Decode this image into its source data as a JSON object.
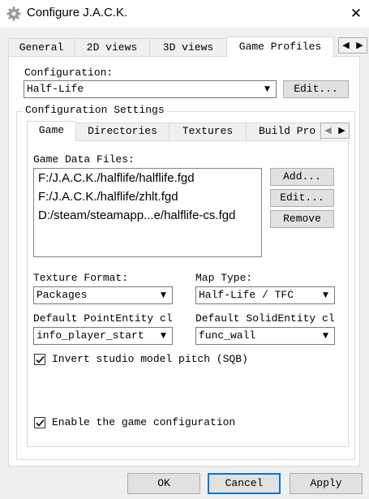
{
  "window": {
    "title": "Configure J.A.C.K.",
    "close_glyph": "✕",
    "icon": "gear-icon"
  },
  "outer_tabs": [
    {
      "label": "General"
    },
    {
      "label": "2D views"
    },
    {
      "label": "3D views"
    },
    {
      "label": "Game Profiles"
    }
  ],
  "outer_tabs_active": "Game Profiles",
  "scroll_arrows": {
    "left": "◀",
    "right": "▶"
  },
  "configuration": {
    "label": "Configuration:",
    "value": "Half-Life",
    "edit_button": "Edit..."
  },
  "settings_group": {
    "title": "Configuration Settings"
  },
  "inner_tabs": [
    {
      "label": "Game"
    },
    {
      "label": "Directories"
    },
    {
      "label": "Textures"
    },
    {
      "label": "Build Pro"
    }
  ],
  "inner_tabs_active": "Game",
  "game": {
    "data_files_label": "Game Data Files:",
    "data_files": [
      "F:/J.A.C.K./halflife/halflife.fgd",
      "F:/J.A.C.K./halflife/zhlt.fgd",
      "D:/steam/steamapp...e/halflife-cs.fgd"
    ],
    "add_button": "Add...",
    "edit_button": "Edit...",
    "remove_button": "Remove",
    "texture_format_label": "Texture Format:",
    "texture_format_value": "Packages",
    "map_type_label": "Map Type:",
    "map_type_value": "Half-Life / TFC",
    "point_entity_label": "Default PointEntity cl",
    "point_entity_value": "info_player_start",
    "solid_entity_label": "Default SolidEntity cl",
    "solid_entity_value": "func_wall",
    "invert_pitch_label": "Invert studio model pitch (SQB)",
    "invert_pitch_checked": true,
    "enable_label": "Enable the game configuration",
    "enable_checked": true
  },
  "dialog_buttons": {
    "ok": "OK",
    "cancel": "Cancel",
    "apply": "Apply"
  },
  "colors": {
    "focus_border": "#0078d7",
    "dialog_bg": "#f0f0f0"
  }
}
